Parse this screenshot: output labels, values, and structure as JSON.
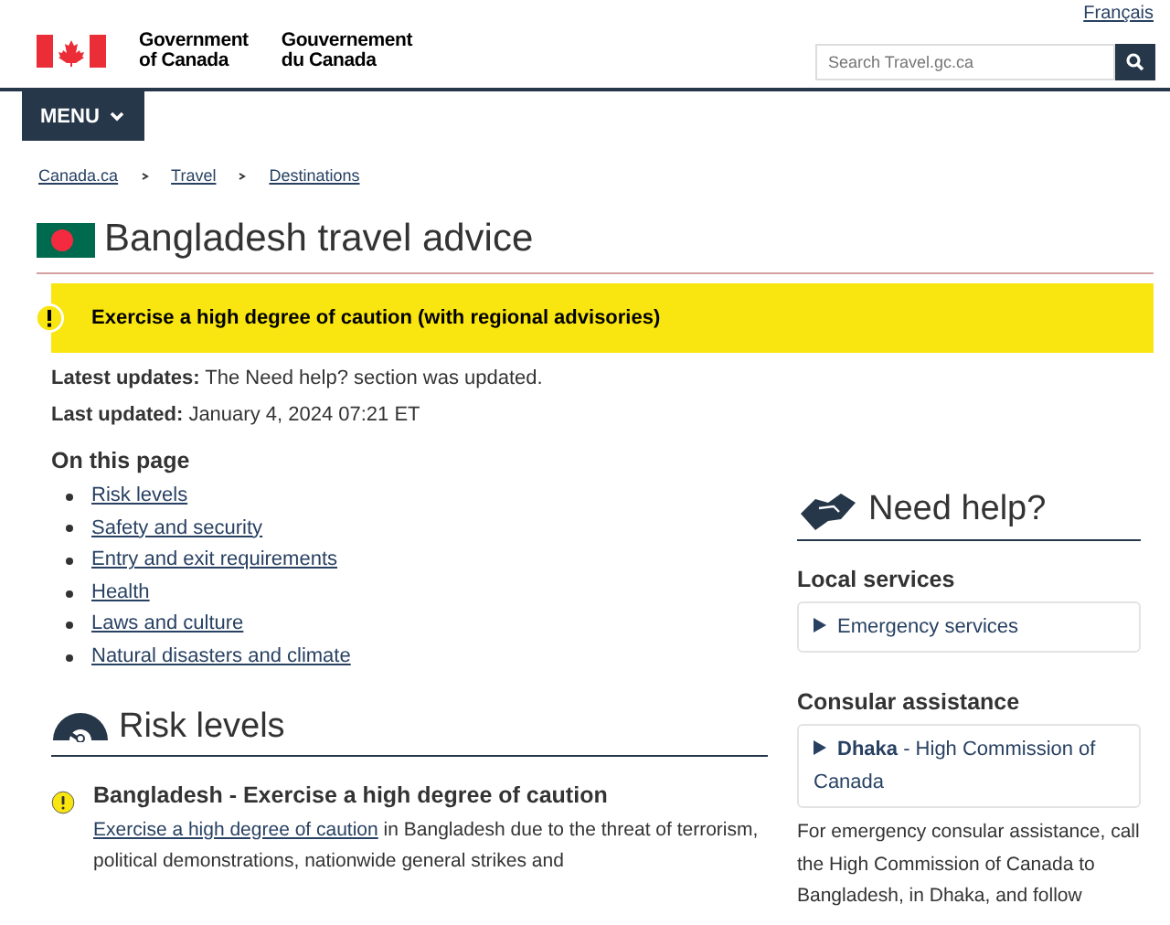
{
  "header": {
    "language_link": "Français",
    "signature": {
      "en_line1": "Government",
      "en_line2": "of Canada",
      "fr_line1": "Gouvernement",
      "fr_line2": "du Canada"
    },
    "search": {
      "placeholder": "Search Travel.gc.ca"
    }
  },
  "menu": {
    "label": "MENU"
  },
  "breadcrumb": [
    {
      "label": "Canada.ca"
    },
    {
      "label": "Travel"
    },
    {
      "label": "Destinations"
    }
  ],
  "page_title": "Bangladesh travel advice",
  "advisory_banner": "Exercise a high degree of caution (with regional advisories)",
  "updates": [
    {
      "label": "Latest updates:",
      "text": "The Need help? section was updated."
    },
    {
      "label": "Last updated:",
      "text": "January 4, 2024 07:21 ET"
    }
  ],
  "on_this_page": {
    "heading": "On this page",
    "links": [
      "Risk levels",
      "Safety and security",
      "Entry and exit requirements",
      "Health",
      "Laws and culture",
      "Natural disasters and climate"
    ]
  },
  "risk_levels": {
    "heading": "Risk levels",
    "item_title": "Bangladesh - Exercise a high degree of caution",
    "link": "Exercise a high degree of caution",
    "text": " in Bangladesh due to the threat of terrorism, political demonstrations, nationwide general strikes and"
  },
  "need_help": {
    "heading": "Need help?",
    "sections": [
      {
        "heading": "Local services",
        "summary": "Emergency services",
        "expanded": false
      },
      {
        "heading": "Consular assistance",
        "summary": "**Dhaka** - High Commission of Canada",
        "expanded": false
      }
    ],
    "text": "For emergency consular assistance, call the High Commission of Canada to Bangladesh, in Dhaka, and follow"
  }
}
